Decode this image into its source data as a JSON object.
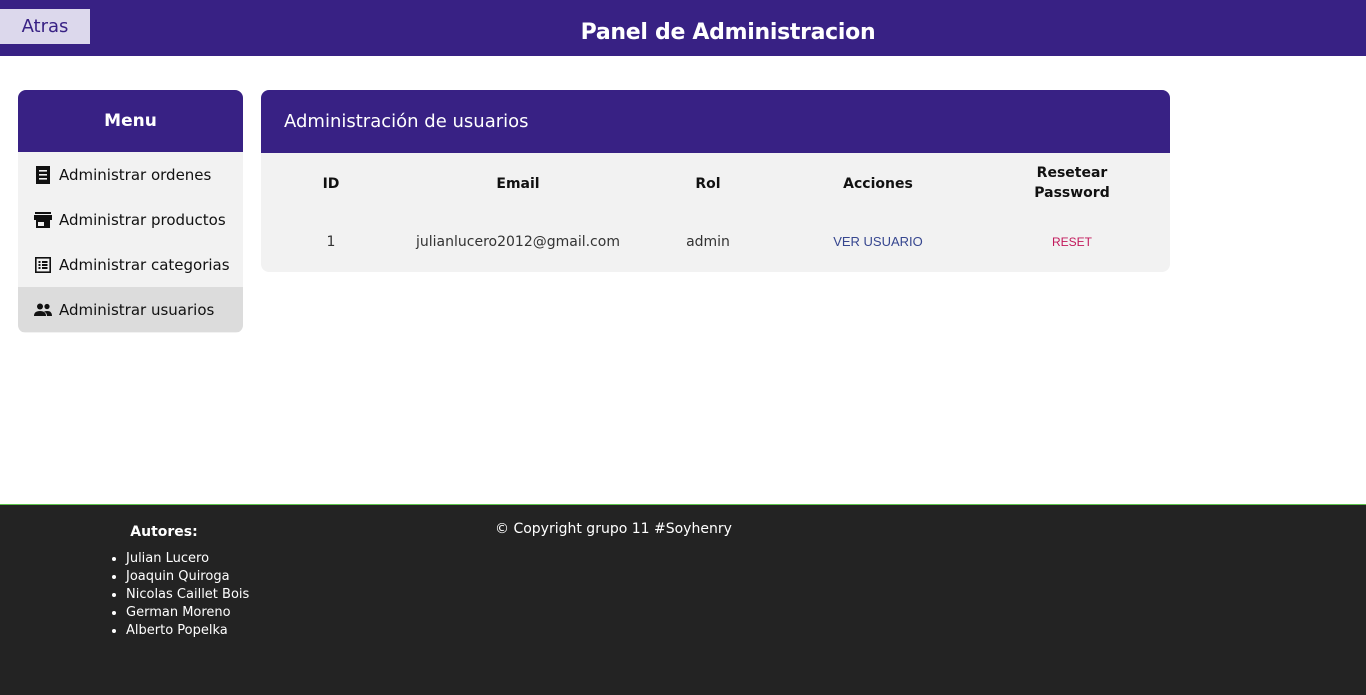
{
  "header": {
    "back_label": "Atras",
    "title": "Panel de Administracion"
  },
  "sidebar": {
    "title": "Menu",
    "items": [
      {
        "label": "Administrar ordenes",
        "icon": "receipt-icon"
      },
      {
        "label": "Administrar productos",
        "icon": "store-icon"
      },
      {
        "label": "Administrar categorias",
        "icon": "list-icon"
      },
      {
        "label": "Administrar usuarios",
        "icon": "people-icon",
        "active": true
      }
    ]
  },
  "main": {
    "title": "Administración de usuarios",
    "columns": [
      "ID",
      "Email",
      "Rol",
      "Acciones",
      "Resetear Password"
    ],
    "rows": [
      {
        "id": "1",
        "email": "julianlucero2012@gmail.com",
        "rol": "admin",
        "action": "VER USUARIO",
        "reset": "RESET"
      }
    ]
  },
  "footer": {
    "authors_title": "Autores:",
    "authors": [
      "Julian Lucero",
      "Joaquin Quiroga",
      "Nicolas Caillet Bois",
      "German Moreno",
      "Alberto Popelka"
    ],
    "copyright": "© Copyright grupo 11 #Soyhenry"
  },
  "colors": {
    "brand": "#382184",
    "accent_link": "#36468f",
    "reset_link": "#c2185b",
    "footer_bg": "#232323"
  }
}
